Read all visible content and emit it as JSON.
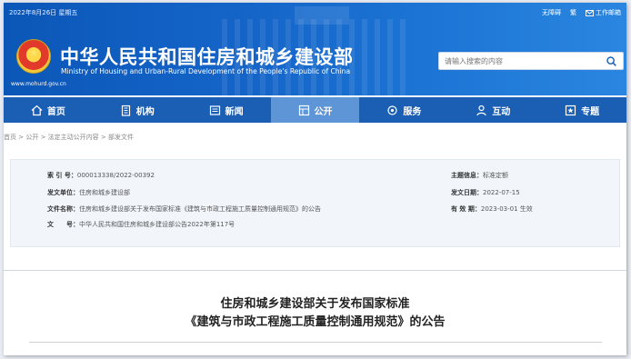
{
  "header": {
    "date": "2022年8月26日 星期五",
    "toplinks": [
      {
        "label": "无障碍",
        "icon": "accessibility-icon"
      },
      {
        "label": "繁",
        "icon": ""
      },
      {
        "label": "工作邮箱",
        "icon": "mail-icon"
      }
    ],
    "title": "中华人民共和国住房和城乡建设部",
    "subtitle": "Ministry of Housing and Urban-Rural Development of the People's Republic of China",
    "url": "www.mohurd.gov.cn"
  },
  "search": {
    "placeholder": "请输入搜索的内容"
  },
  "nav": [
    {
      "label": "首页",
      "icon": "home-icon"
    },
    {
      "label": "机构",
      "icon": "building-icon"
    },
    {
      "label": "新闻",
      "icon": "news-icon"
    },
    {
      "label": "公开",
      "icon": "document-icon",
      "active": true
    },
    {
      "label": "服务",
      "icon": "service-icon"
    },
    {
      "label": "互动",
      "icon": "interact-icon"
    },
    {
      "label": "专题",
      "icon": "topic-icon"
    }
  ],
  "breadcrumb": [
    "首页",
    "公开",
    "法定主动公开内容",
    "部发文件"
  ],
  "info": {
    "index_label": "索 引 号：",
    "index_value": "000013338/2022-00392",
    "issuer_label": "发文单位：",
    "issuer_value": "住房和城乡建设部",
    "filename_label": "文件名称：",
    "filename_value": "住房和城乡建设部关于发布国家标准《建筑与市政工程施工质量控制通用规范》的公告",
    "docno_label": "文　　号：",
    "docno_value": "中华人民共和国住房和城乡建设部公告2022年第117号",
    "topic_label": "主题信息：",
    "topic_value": "标准定额",
    "date_label": "发文日期：",
    "date_value": "2022-07-15",
    "valid_label": "有 效 期：",
    "valid_value": "2023-03-01 生效"
  },
  "article": {
    "title_line1": "住房和城乡建设部关于发布国家标准",
    "title_line2": "《建筑与市政工程施工质量控制通用规范》的公告"
  },
  "colors": {
    "header_blue": "#1565c9",
    "nav_blue": "#1a5fb4",
    "nav_active": "#5d95d6",
    "info_bg": "#f2f6fb"
  }
}
